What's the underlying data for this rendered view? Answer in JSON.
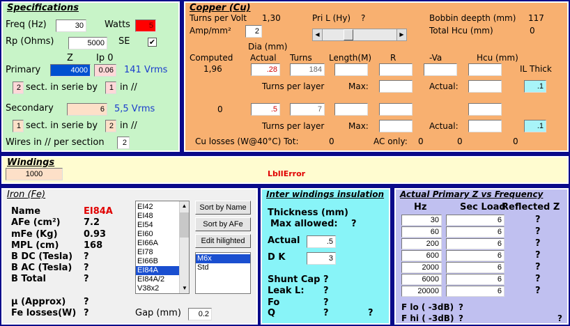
{
  "specs": {
    "title": "Specifications",
    "freq_label": "Freq (Hz)",
    "freq_value": "30",
    "watts_label": "Watts",
    "watts_value": "5",
    "rp_label": "Rp (Ohms)",
    "rp_value": "5000",
    "se_label": "SE",
    "se_check": "✔",
    "z_header": "Z",
    "ip0_header": "Ip 0",
    "primary_label": "Primary",
    "primary_z": "4000",
    "primary_ip0": "0.06",
    "primary_vrms": "141 Vrms",
    "prim_sect": "2",
    "sect_text": "sect. in serie by",
    "prim_par": "1",
    "in_text": "in //",
    "secondary_label": "Secondary",
    "secondary_z": "6",
    "secondary_vrms": "5,5 Vrms",
    "sec_sect": "1",
    "sec_par": "2",
    "wires_label": "Wires in // per section",
    "wires_value": "2"
  },
  "copper": {
    "title": "Copper (Cu)",
    "tpv_label": "Turns per Volt",
    "tpv_value": "1,30",
    "pril_label": "Pri L (Hy)",
    "pril_value": "?",
    "bobbin_label": "Bobbin deepth (mm)",
    "bobbin_value": "117",
    "amp_label": "Amp/mm²",
    "amp_value": "2",
    "thcu_label": "Total Hcu (mm)",
    "thcu_value": "0",
    "dia_label": "Dia (mm)",
    "computed_label": "Computed",
    "actual_label": "Actual",
    "turns_label": "Turns",
    "length_label": "Length(M)",
    "r_label": "R",
    "va_label": "-Va",
    "hcu_label": "Hcu (mm)",
    "ilthick_label": "IL Thick",
    "prim_computed": "1,96",
    "prim_actual": ".28",
    "prim_turns": "184",
    "prim_il": ".1",
    "tpl_label": "Turns per layer",
    "max_label": "Max:",
    "actual2_label": "Actual:",
    "sec_computed": "0",
    "sec_actual": ".5",
    "sec_turns": "7",
    "sec_il": ".1",
    "culoss_label": "Cu losses (W@40°C) Tot:",
    "culoss_tot": "0",
    "aconly_label": "AC only:",
    "aconly_1": "0",
    "aconly_2": "0",
    "aconly_3": "0"
  },
  "windings": {
    "title": "Windings",
    "value": "1000",
    "error": "LblIError"
  },
  "iron": {
    "title": "Iron (Fe)",
    "name_label": "Name",
    "name_value": "EI84A",
    "afe_label": "AFe (cm²)",
    "afe_value": "7.2",
    "mfe_label": "mFe (Kg)",
    "mfe_value": "0.93",
    "mpl_label": "MPL (cm)",
    "mpl_value": "168",
    "bdc_label": "B DC (Tesla)",
    "bdc_value": "?",
    "bac_label": "B AC (Tesla)",
    "bac_value": "?",
    "btot_label": "B Total",
    "btot_value": "?",
    "mu_label": "µ (Approx)",
    "mu_value": "?",
    "fel_label": "Fe losses(W)",
    "fel_value": "?",
    "gap_label": "Gap (mm)",
    "gap_value": "0.2",
    "cores": [
      "EI42",
      "EI48",
      "EI54",
      "EI60",
      "EI66A",
      "EI78",
      "EI66B",
      "EI84A",
      "EI84A/2",
      "V38x2"
    ],
    "selected_core_index": 7,
    "materials": [
      "M6x",
      "Std"
    ],
    "selected_material_index": 0,
    "sort_name": "Sort by Name",
    "sort_afe": "Sort by AFe",
    "edit": "Edit hilighted"
  },
  "inter": {
    "title": "Inter windings insulation",
    "thick_label": "Thickness (mm)",
    "max_label": "Max allowed:",
    "max_value": "?",
    "actual_label": "Actual",
    "actual_value": ".5",
    "dk_label": "D K",
    "dk_value": "3",
    "shunt_label": "Shunt Cap",
    "shunt_value": "?",
    "leak_label": "Leak L:",
    "leak_value": "?",
    "fo_label": "Fo",
    "fo_value": "?",
    "q_label": "Q",
    "q_value": "?",
    "q_value2": "?"
  },
  "zfreq": {
    "title": "Actual Primary Z vs Frequency",
    "hz_header": "Hz",
    "load_header": "Sec Load",
    "refl_header": "Reflected Z",
    "rows": [
      {
        "hz": "30",
        "load": "6",
        "refl": "?"
      },
      {
        "hz": "60",
        "load": "6",
        "refl": "?"
      },
      {
        "hz": "200",
        "load": "6",
        "refl": "?"
      },
      {
        "hz": "600",
        "load": "6",
        "refl": "?"
      },
      {
        "hz": "2000",
        "load": "6",
        "refl": "?"
      },
      {
        "hz": "6000",
        "load": "6",
        "refl": "?"
      },
      {
        "hz": "20000",
        "load": "6",
        "refl": "?"
      }
    ],
    "flo_label": "F lo ( -3dB)",
    "flo_value": "?",
    "fhi_label": "F hi ( -3dB)",
    "fhi_value": "?",
    "fhi_value2": "?"
  },
  "colors": {
    "specs_bg": "#c8f4c8",
    "copper_bg": "#f8b070",
    "windings_bg": "#fffcd0",
    "iron_bg": "#f0f0f0",
    "inter_bg": "#88f4f8",
    "zfreq_bg": "#c0c0f0",
    "body_bg": "#0a0a8a"
  }
}
